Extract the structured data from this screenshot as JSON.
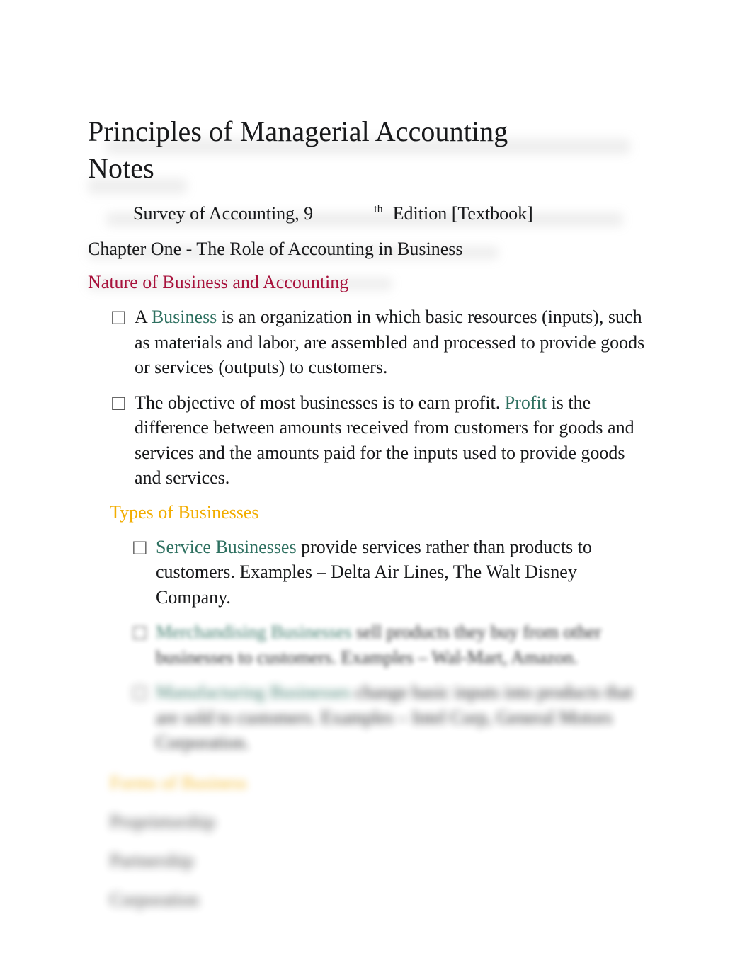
{
  "document": {
    "title": "Principles of Managerial Accounting Notes",
    "subtitle": {
      "lead": "Survey of Accounting, 9",
      "superscript": "th",
      "tail": "Edition [Textbook]"
    },
    "chapter_heading": "Chapter One - The Role of Accounting in Business",
    "section_heading": "Nature of Business and Accounting",
    "bullet_marker": "□",
    "bullets": [
      {
        "term": "Business",
        "before": "A ",
        "after": " is an organization in which basic resources (inputs), such as materials and labor, are assembled and processed to provide goods or services (outputs) to customers."
      },
      {
        "term": "Profit",
        "before": "The objective of most businesses is to earn profit. ",
        "after": " is the difference between amounts received from customers for goods and services and the amounts paid for the inputs used to provide goods and services."
      }
    ],
    "types_heading": "Types of Businesses",
    "type_bullets": [
      {
        "term": "Service Businesses",
        "before": "",
        "after": " provide services rather than products to customers. Examples – Delta Air Lines, The Walt Disney Company."
      },
      {
        "term": "Merchandising Businesses",
        "before": "",
        "after": " sell products they buy from other businesses to customers. Examples – Wal-Mart, Amazon."
      },
      {
        "term": "Manufacturing Businesses",
        "before": "",
        "after": " change basic inputs into products that are sold to customers. Examples – Intel Corp, General Motors Corporation."
      }
    ],
    "forms_heading": "Forms of Business",
    "forms": [
      "Proprietorship",
      "Partnership",
      "Corporation"
    ]
  },
  "colors": {
    "heading_crimson": "#a8123c",
    "heading_amber": "#f2ad00",
    "term_teal": "#2e7060",
    "body_text": "#18191b",
    "page_background": "#ffffff"
  }
}
